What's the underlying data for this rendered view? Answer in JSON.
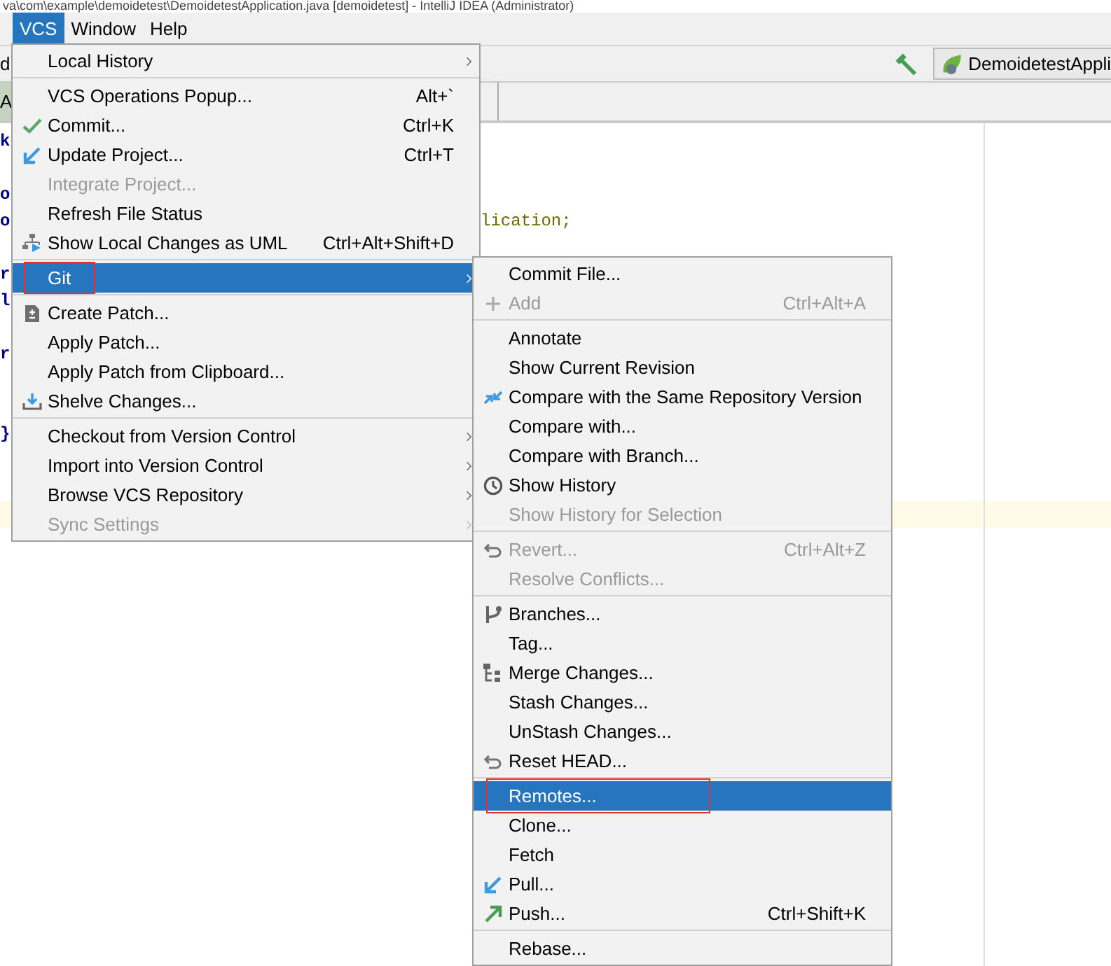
{
  "window": {
    "title": "va\\com\\example\\demoidetest\\DemoidetestApplication.java [demoidetest] - IntelliJ IDEA (Administrator)"
  },
  "menubar": [
    {
      "label": "VCS",
      "selected": true
    },
    {
      "label": "Window",
      "selected": false
    },
    {
      "label": "Help",
      "selected": false
    }
  ],
  "toolbar": {
    "fragment": "d",
    "run_configuration": "DemoidetestAppli"
  },
  "editor_tabs": [
    {
      "label": "A"
    }
  ],
  "editor": {
    "lines": [
      {
        "gutter_text": "k",
        "current": false
      },
      {
        "current": false
      },
      {
        "gutter_text": "o",
        "current": false
      },
      {
        "gutter_text": "o",
        "text": "lication;",
        "current": false
      },
      {
        "current": false
      },
      {
        "gutter_text": "r",
        "current": false
      },
      {
        "gutter_text": "l",
        "current": false
      },
      {
        "current": false
      },
      {
        "gutter_text": "r",
        "current": false
      },
      {
        "current": false
      },
      {
        "current": false
      },
      {
        "gutter_text": "}",
        "current": false
      },
      {
        "current": false
      },
      {
        "current": false
      },
      {
        "current": true
      }
    ]
  },
  "vcs_menu": {
    "groups": [
      [
        {
          "label": "Local History",
          "kind": "plain",
          "submenu": true,
          "disabled": false,
          "selected": false,
          "highlighted": false
        }
      ],
      [
        {
          "label": "VCS Operations Popup...",
          "kind": "plain",
          "shortcut": "Alt+`",
          "submenu": false,
          "disabled": false,
          "selected": false,
          "highlighted": false
        },
        {
          "label": "Commit...",
          "kind": "check",
          "shortcut": "Ctrl+K",
          "submenu": false,
          "disabled": false,
          "selected": false,
          "highlighted": false
        },
        {
          "label": "Update Project...",
          "kind": "update",
          "shortcut": "Ctrl+T",
          "submenu": false,
          "disabled": false,
          "selected": false,
          "highlighted": false
        },
        {
          "label": "Integrate Project...",
          "kind": "plain",
          "submenu": false,
          "disabled": true,
          "selected": false,
          "highlighted": false
        },
        {
          "label": "Refresh File Status",
          "kind": "plain",
          "submenu": false,
          "disabled": false,
          "selected": false,
          "highlighted": false
        },
        {
          "label": "Show Local Changes as UML",
          "kind": "diagram",
          "shortcut": "Ctrl+Alt+Shift+D",
          "submenu": false,
          "disabled": false,
          "selected": false,
          "highlighted": false
        }
      ],
      [
        {
          "label": "Git",
          "kind": "plain",
          "submenu": true,
          "disabled": false,
          "selected": true,
          "highlighted": true
        }
      ],
      [
        {
          "label": "Create Patch...",
          "kind": "patch",
          "submenu": false,
          "disabled": false,
          "selected": false,
          "highlighted": false
        },
        {
          "label": "Apply Patch...",
          "kind": "plain",
          "submenu": false,
          "disabled": false,
          "selected": false,
          "highlighted": false
        },
        {
          "label": "Apply Patch from Clipboard...",
          "kind": "plain",
          "submenu": false,
          "disabled": false,
          "selected": false,
          "highlighted": false
        },
        {
          "label": "Shelve Changes...",
          "kind": "shelve",
          "submenu": false,
          "disabled": false,
          "selected": false,
          "highlighted": false
        }
      ],
      [
        {
          "label": "Checkout from Version Control",
          "kind": "plain",
          "submenu": true,
          "disabled": false,
          "selected": false,
          "highlighted": false
        },
        {
          "label": "Import into Version Control",
          "kind": "plain",
          "submenu": true,
          "disabled": false,
          "selected": false,
          "highlighted": false
        },
        {
          "label": "Browse VCS Repository",
          "kind": "plain",
          "submenu": true,
          "disabled": false,
          "selected": false,
          "highlighted": false
        },
        {
          "label": "Sync Settings",
          "kind": "plain",
          "submenu": true,
          "disabled": true,
          "selected": false,
          "highlighted": false
        }
      ]
    ]
  },
  "git_menu": {
    "groups": [
      [
        {
          "label": "Commit File...",
          "kind": "plain",
          "submenu": false,
          "disabled": false,
          "selected": false,
          "highlighted": false
        },
        {
          "label": "Add",
          "kind": "add",
          "shortcut": "Ctrl+Alt+A",
          "submenu": false,
          "disabled": true,
          "selected": false,
          "highlighted": false
        }
      ],
      [
        {
          "label": "Annotate",
          "kind": "plain",
          "submenu": false,
          "disabled": false,
          "selected": false,
          "highlighted": false
        },
        {
          "label": "Show Current Revision",
          "kind": "plain",
          "submenu": false,
          "disabled": false,
          "selected": false,
          "highlighted": false
        },
        {
          "label": "Compare with the Same Repository Version",
          "kind": "compare",
          "submenu": false,
          "disabled": false,
          "selected": false,
          "highlighted": false
        },
        {
          "label": "Compare with...",
          "kind": "plain",
          "submenu": false,
          "disabled": false,
          "selected": false,
          "highlighted": false
        },
        {
          "label": "Compare with Branch...",
          "kind": "plain",
          "submenu": false,
          "disabled": false,
          "selected": false,
          "highlighted": false
        },
        {
          "label": "Show History",
          "kind": "history",
          "submenu": false,
          "disabled": false,
          "selected": false,
          "highlighted": false
        },
        {
          "label": "Show History for Selection",
          "kind": "plain",
          "submenu": false,
          "disabled": true,
          "selected": false,
          "highlighted": false
        }
      ],
      [
        {
          "label": "Revert...",
          "kind": "revert",
          "shortcut": "Ctrl+Alt+Z",
          "submenu": false,
          "disabled": true,
          "selected": false,
          "highlighted": false
        },
        {
          "label": "Resolve Conflicts...",
          "kind": "plain",
          "submenu": false,
          "disabled": true,
          "selected": false,
          "highlighted": false
        }
      ],
      [
        {
          "label": "Branches...",
          "kind": "branches",
          "submenu": false,
          "disabled": false,
          "selected": false,
          "highlighted": false
        },
        {
          "label": "Tag...",
          "kind": "plain",
          "submenu": false,
          "disabled": false,
          "selected": false,
          "highlighted": false
        },
        {
          "label": "Merge Changes...",
          "kind": "merge",
          "submenu": false,
          "disabled": false,
          "selected": false,
          "highlighted": false
        },
        {
          "label": "Stash Changes...",
          "kind": "plain",
          "submenu": false,
          "disabled": false,
          "selected": false,
          "highlighted": false
        },
        {
          "label": "UnStash Changes...",
          "kind": "plain",
          "submenu": false,
          "disabled": false,
          "selected": false,
          "highlighted": false
        },
        {
          "label": "Reset HEAD...",
          "kind": "revert",
          "submenu": false,
          "disabled": false,
          "selected": false,
          "highlighted": false
        }
      ],
      [
        {
          "label": "Remotes...",
          "kind": "plain",
          "submenu": false,
          "disabled": false,
          "selected": true,
          "highlighted": true
        },
        {
          "label": "Clone...",
          "kind": "plain",
          "submenu": false,
          "disabled": false,
          "selected": false,
          "highlighted": false
        },
        {
          "label": "Fetch",
          "kind": "plain",
          "submenu": false,
          "disabled": false,
          "selected": false,
          "highlighted": false
        },
        {
          "label": "Pull...",
          "kind": "update",
          "submenu": false,
          "disabled": false,
          "selected": false,
          "highlighted": false
        },
        {
          "label": "Push...",
          "kind": "push",
          "shortcut": "Ctrl+Shift+K",
          "submenu": false,
          "disabled": false,
          "selected": false,
          "highlighted": false
        }
      ],
      [
        {
          "label": "Rebase...",
          "kind": "plain",
          "submenu": false,
          "disabled": false,
          "selected": false,
          "highlighted": false
        }
      ]
    ]
  }
}
